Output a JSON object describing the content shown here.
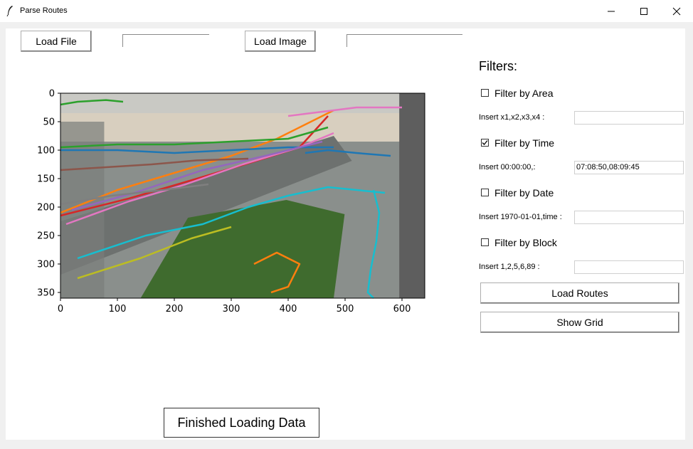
{
  "window": {
    "title": "Parse Routes"
  },
  "toolbar": {
    "load_file": "Load File",
    "load_image": "Load Image",
    "file_path": "",
    "image_path": ""
  },
  "filters": {
    "heading": "Filters:",
    "area": {
      "label": "Filter by Area",
      "checked": false,
      "insert_label": "Insert x1,x2,x3,x4 :",
      "value": ""
    },
    "time": {
      "label": "Filter by Time",
      "checked": true,
      "insert_label": "Insert 00:00:00,:",
      "value": "07:08:50,08:09:45"
    },
    "date": {
      "label": "Filter by Date",
      "checked": false,
      "insert_label": "Insert 1970-01-01,time :",
      "value": ""
    },
    "block": {
      "label": "Filter by Block",
      "checked": false,
      "insert_label": "Insert 1,2,5,6,89 :",
      "value": ""
    }
  },
  "buttons": {
    "load_routes": "Load Routes",
    "show_grid": "Show Grid"
  },
  "status": "Finished Loading Data",
  "chart_data": {
    "type": "line",
    "title": "",
    "xlabel": "",
    "ylabel": "",
    "xlim": [
      0,
      640
    ],
    "ylim": [
      360,
      0
    ],
    "x_ticks": [
      "0",
      "100",
      "200",
      "300",
      "400",
      "500",
      "600"
    ],
    "y_ticks": [
      "0",
      "50",
      "100",
      "150",
      "200",
      "250",
      "300",
      "350"
    ],
    "background": "camera image of road overpass with landscaped garden",
    "series_colors": [
      "#1f77b4",
      "#ff7f0e",
      "#2ca02c",
      "#d62728",
      "#9467bd",
      "#8c564b",
      "#e377c2",
      "#7f7f7f",
      "#bcbd22",
      "#17becf"
    ],
    "series": [
      {
        "color": "#ff7f0e",
        "x": [
          0,
          100,
          200,
          300,
          380,
          460,
          480
        ],
        "y": [
          210,
          170,
          140,
          110,
          80,
          40,
          30
        ]
      },
      {
        "color": "#1f77b4",
        "x": [
          0,
          100,
          200,
          300,
          400,
          480
        ],
        "y": [
          100,
          100,
          105,
          100,
          95,
          95
        ]
      },
      {
        "color": "#d62728",
        "x": [
          0,
          120,
          240,
          340,
          420,
          470
        ],
        "y": [
          215,
          185,
          150,
          120,
          95,
          40
        ]
      },
      {
        "color": "#2ca02c",
        "x": [
          0,
          100,
          200,
          300,
          400,
          470
        ],
        "y": [
          95,
          90,
          90,
          85,
          80,
          60
        ]
      },
      {
        "color": "#e377c2",
        "x": [
          10,
          120,
          220,
          320,
          420,
          480
        ],
        "y": [
          230,
          190,
          160,
          125,
          95,
          70
        ]
      },
      {
        "color": "#17becf",
        "x": [
          30,
          150,
          250,
          330,
          400,
          470,
          570
        ],
        "y": [
          290,
          250,
          230,
          200,
          180,
          165,
          175
        ]
      },
      {
        "color": "#9467bd",
        "x": [
          20,
          130,
          250,
          360,
          460
        ],
        "y": [
          205,
          175,
          135,
          110,
          85
        ]
      },
      {
        "color": "#bcbd22",
        "x": [
          30,
          140,
          230,
          300
        ],
        "y": [
          325,
          290,
          255,
          235
        ]
      },
      {
        "color": "#8c564b",
        "x": [
          0,
          80,
          160,
          240,
          330
        ],
        "y": [
          135,
          130,
          125,
          118,
          115
        ]
      },
      {
        "color": "#7f7f7f",
        "x": [
          0,
          90,
          180,
          260
        ],
        "y": [
          195,
          180,
          170,
          160
        ]
      },
      {
        "color": "#17becf",
        "x": [
          550,
          560,
          555,
          545,
          540,
          550
        ],
        "y": [
          170,
          210,
          260,
          310,
          350,
          360
        ]
      },
      {
        "color": "#ff7f0e",
        "x": [
          340,
          380,
          420,
          400,
          370
        ],
        "y": [
          300,
          280,
          300,
          340,
          350
        ]
      },
      {
        "color": "#2ca02c",
        "x": [
          0,
          30,
          80,
          110
        ],
        "y": [
          20,
          15,
          12,
          15
        ]
      },
      {
        "color": "#1f77b4",
        "x": [
          430,
          470,
          520,
          580
        ],
        "y": [
          105,
          100,
          105,
          110
        ]
      },
      {
        "color": "#e377c2",
        "x": [
          400,
          440,
          480,
          520,
          600
        ],
        "y": [
          40,
          35,
          30,
          25,
          25
        ]
      }
    ]
  }
}
